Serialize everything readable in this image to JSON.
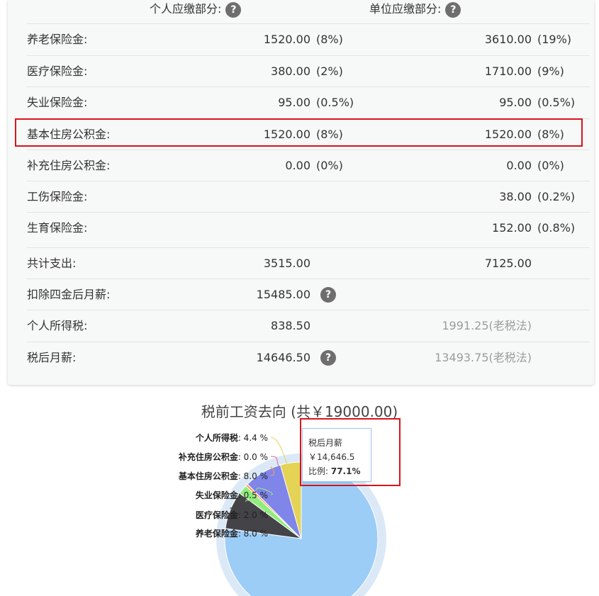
{
  "table": {
    "header_personal": "个人应缴部分:",
    "header_unit": "单位应缴部分:",
    "help_glyph": "?",
    "rows": [
      {
        "label": "养老保险金:",
        "p_val": "1520.00",
        "p_pct": "(8%)",
        "u_val": "3610.00",
        "u_pct": "(19%)"
      },
      {
        "label": "医疗保险金:",
        "p_val": "380.00",
        "p_pct": "(2%)",
        "u_val": "1710.00",
        "u_pct": "(9%)"
      },
      {
        "label": "失业保险金:",
        "p_val": "95.00",
        "p_pct": "(0.5%)",
        "u_val": "95.00",
        "u_pct": "(0.5%)"
      },
      {
        "label": "基本住房公积金:",
        "p_val": "1520.00",
        "p_pct": "(8%)",
        "u_val": "1520.00",
        "u_pct": "(8%)"
      },
      {
        "label": "补充住房公积金:",
        "p_val": "0.00",
        "p_pct": "(0%)",
        "u_val": "0.00",
        "u_pct": "(0%)"
      },
      {
        "label": "工伤保险金:",
        "p_val": "",
        "p_pct": "",
        "u_val": "38.00",
        "u_pct": "(0.2%)"
      },
      {
        "label": "生育保险金:",
        "p_val": "",
        "p_pct": "",
        "u_val": "152.00",
        "u_pct": "(0.8%)"
      }
    ],
    "total": {
      "label": "共计支出:",
      "p_val": "3515.00",
      "u_val": "7125.00"
    },
    "after_deduction": {
      "label": "扣除四金后月薪:",
      "value": "15485.00"
    },
    "income_tax": {
      "label": "个人所得税:",
      "value": "838.50",
      "old_value": "1991.25(老税法)"
    },
    "net_salary": {
      "label": "税后月薪:",
      "value": "14646.50",
      "old_value": "13493.75(老税法)"
    }
  },
  "chart_data": {
    "type": "pie",
    "title": "税前工资去向 (共￥19000.00)",
    "slices": [
      {
        "name": "税后月薪",
        "value": 77.1,
        "color": "#9ccdf7"
      },
      {
        "name": "养老保险金",
        "value": 8.0,
        "color": "#434348"
      },
      {
        "name": "医疗保险金",
        "value": 2.0,
        "color": "#90ed7d"
      },
      {
        "name": "失业保险金",
        "value": 0.5,
        "color": "#f7a35c"
      },
      {
        "name": "基本住房公积金",
        "value": 8.0,
        "color": "#8085e9"
      },
      {
        "name": "补充住房公积金",
        "value": 0.0,
        "color": "#f15c80"
      },
      {
        "name": "个人所得税",
        "value": 4.4,
        "color": "#e4d354"
      }
    ],
    "labels": [
      {
        "name": "个人所得税",
        "text": ": 4.4 %",
        "color": "#e4d354"
      },
      {
        "name": "补充住房公积金",
        "text": ": 0.0 %",
        "color": "#f15c80"
      },
      {
        "name": "基本住房公积金",
        "text": ": 8.0 %",
        "color": "#f7a35c"
      },
      {
        "name": "失业保险金",
        "text": ": 0.5 %",
        "color": "#90ed7d"
      },
      {
        "name": "医疗保险金",
        "text": ": 2.0 %",
        "color": "#90ed7d"
      },
      {
        "name": "养老保险金",
        "text": ": 8.0 %",
        "color": "#434348"
      }
    ],
    "tooltip": {
      "title": "税后月薪",
      "amount": "￥14,646.5",
      "ratio_label": "比例: ",
      "ratio_value": "77.1%"
    }
  }
}
